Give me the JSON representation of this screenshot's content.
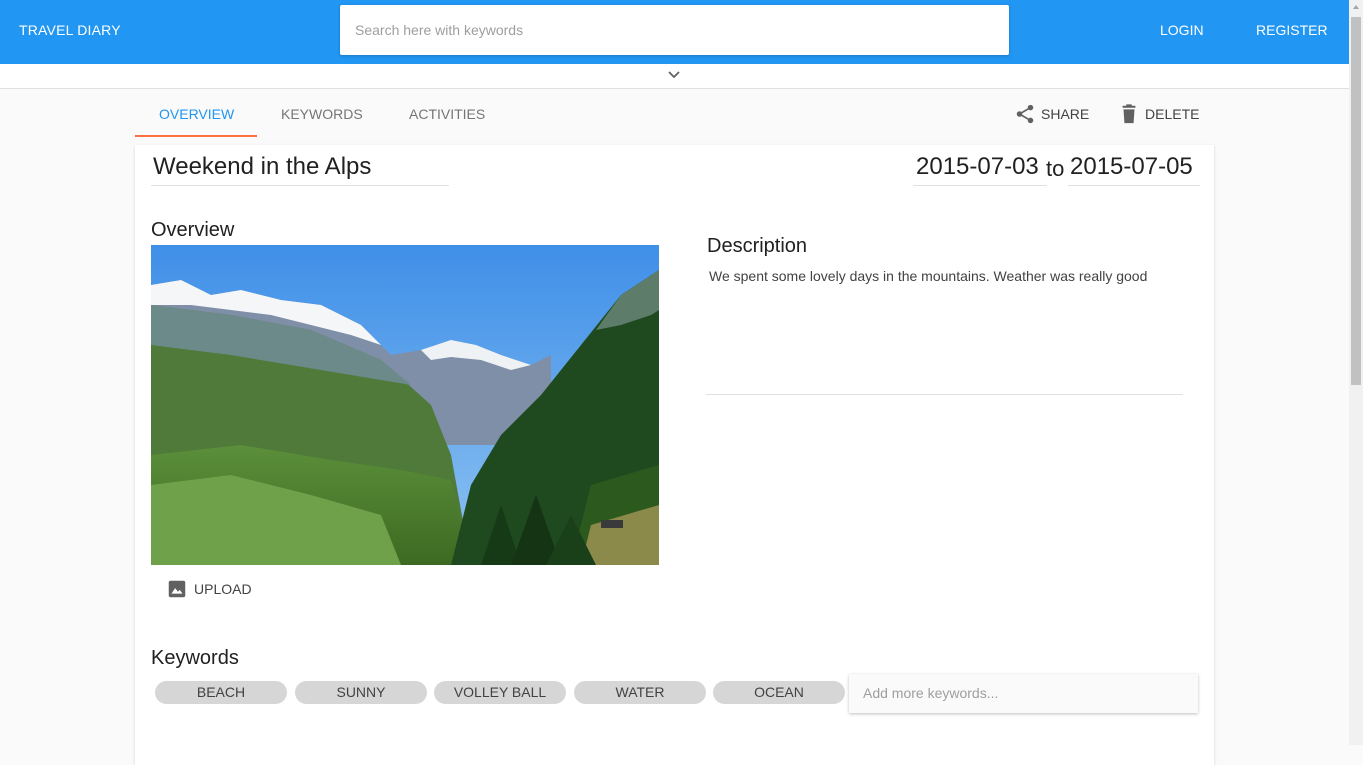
{
  "appbar": {
    "brand": "TRAVEL DIARY",
    "search_placeholder": "Search here with keywords",
    "login_label": "LOGIN",
    "register_label": "REGISTER",
    "color": "#2196f3"
  },
  "tabs": [
    {
      "label": "OVERVIEW",
      "active": true
    },
    {
      "label": "KEYWORDS",
      "active": false
    },
    {
      "label": "ACTIVITIES",
      "active": false
    }
  ],
  "actions": {
    "share_label": "SHARE",
    "delete_label": "DELETE"
  },
  "trip": {
    "title": "Weekend in the Alps",
    "date_from": "2015-07-03",
    "to_label": "to",
    "date_to": "2015-07-05"
  },
  "overview": {
    "heading": "Overview",
    "photo_icon": "mountain-landscape-photo",
    "upload_label": "UPLOAD"
  },
  "description": {
    "heading": "Description",
    "text": "We spent some lovely days in the mountains. Weather was really good"
  },
  "keywords": {
    "heading": "Keywords",
    "chips": [
      "BEACH",
      "SUNNY",
      "VOLLEY BALL",
      "WATER",
      "OCEAN"
    ],
    "input_placeholder": "Add more keywords..."
  },
  "colors": {
    "accent": "#2196f3",
    "tab_ink": "#ff7043",
    "chip_bg": "#d6d6d6"
  }
}
